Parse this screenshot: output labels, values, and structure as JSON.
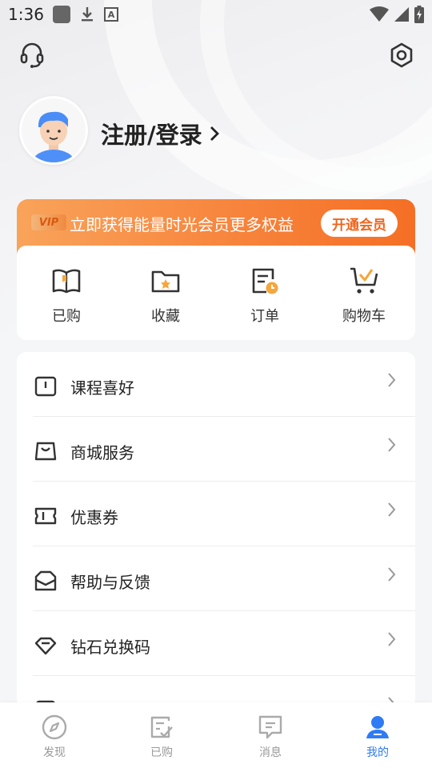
{
  "status_bar": {
    "time": "1:36"
  },
  "profile": {
    "login_label": "注册/登录"
  },
  "vip": {
    "badge": "VIP",
    "text": "立即获得能量时光会员更多权益",
    "button": "开通会员"
  },
  "quick_actions": [
    {
      "label": "已购",
      "icon": "open-book-icon"
    },
    {
      "label": "收藏",
      "icon": "folder-star-icon"
    },
    {
      "label": "订单",
      "icon": "order-clock-icon"
    },
    {
      "label": "购物车",
      "icon": "shopping-cart-icon"
    }
  ],
  "menu": [
    {
      "label": "课程喜好",
      "icon": "book-bookmark-icon"
    },
    {
      "label": "商城服务",
      "icon": "shopping-bag-icon"
    },
    {
      "label": "优惠券",
      "icon": "ticket-icon"
    },
    {
      "label": "帮助与反馈",
      "icon": "inbox-icon"
    },
    {
      "label": "钻石兑换码",
      "icon": "diamond-icon"
    }
  ],
  "bottom_nav": [
    {
      "label": "发现",
      "icon": "compass-icon",
      "active": false
    },
    {
      "label": "已购",
      "icon": "purchased-check-icon",
      "active": false
    },
    {
      "label": "消息",
      "icon": "message-icon",
      "active": false
    },
    {
      "label": "我的",
      "icon": "person-icon",
      "active": true
    }
  ],
  "colors": {
    "accent_orange": "#f7843c",
    "active_blue": "#2f7bf6",
    "icon_orange": "#f5a63c"
  }
}
